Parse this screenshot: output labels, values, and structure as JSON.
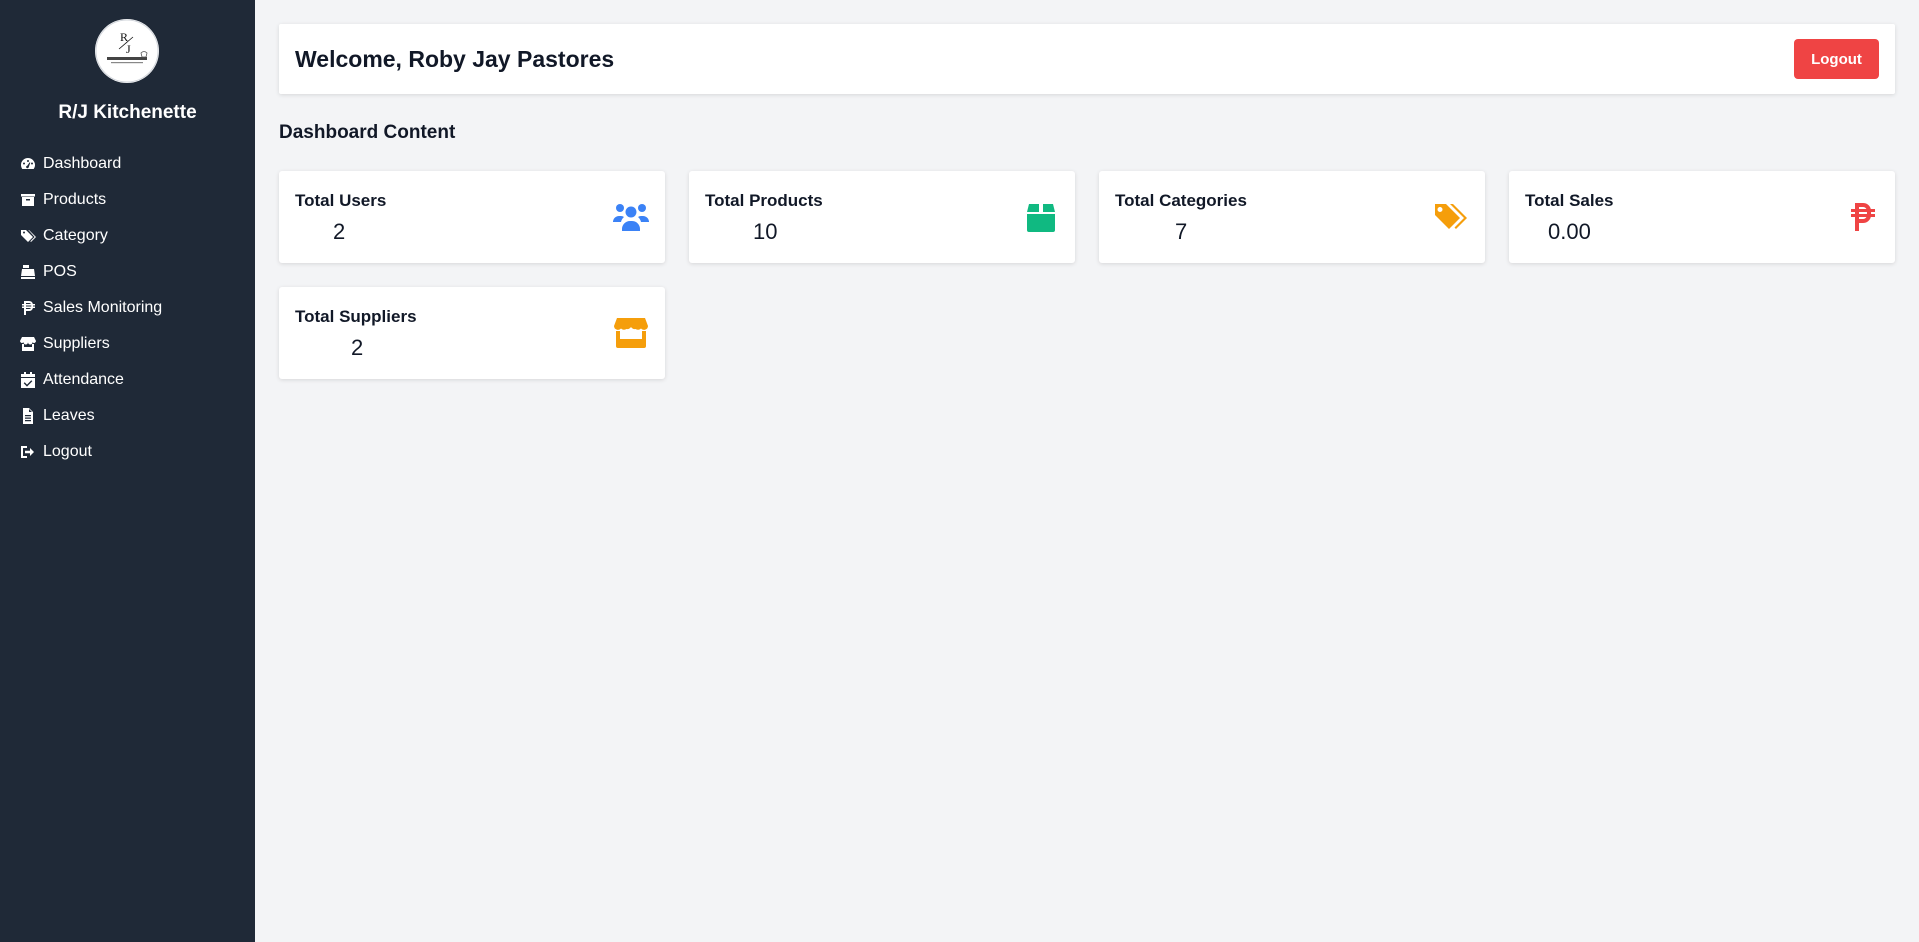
{
  "sidebar": {
    "brand": "R/J Kitchenette",
    "logo_text": "R/J KITCHENETTE",
    "items": [
      {
        "label": "Dashboard",
        "icon": "gauge-icon"
      },
      {
        "label": "Products",
        "icon": "box-icon"
      },
      {
        "label": "Category",
        "icon": "tags-icon"
      },
      {
        "label": "POS",
        "icon": "cash-register-icon"
      },
      {
        "label": "Sales Monitoring",
        "icon": "peso-icon"
      },
      {
        "label": "Suppliers",
        "icon": "store-icon"
      },
      {
        "label": "Attendance",
        "icon": "calendar-check-icon"
      },
      {
        "label": "Leaves",
        "icon": "file-icon"
      },
      {
        "label": "Logout",
        "icon": "sign-out-icon"
      }
    ]
  },
  "header": {
    "welcome": "Welcome, Roby Jay Pastores",
    "logout_label": "Logout"
  },
  "main": {
    "section_title": "Dashboard Content",
    "cards": [
      {
        "label": "Total Users",
        "value": "2",
        "icon": "users-icon",
        "color": "#3b82f6"
      },
      {
        "label": "Total Products",
        "value": "10",
        "icon": "box-icon",
        "color": "#10b981"
      },
      {
        "label": "Total Categories",
        "value": "7",
        "icon": "tags-icon",
        "color": "#f59e0b"
      },
      {
        "label": "Total Sales",
        "value": "0.00",
        "icon": "peso-icon",
        "color": "#ef4444"
      },
      {
        "label": "Total Suppliers",
        "value": "2",
        "icon": "store-icon",
        "color": "#f59e0b"
      }
    ]
  },
  "colors": {
    "sidebar_bg": "#1f2937",
    "page_bg": "#f3f4f6",
    "logout_bg": "#ef4444"
  }
}
